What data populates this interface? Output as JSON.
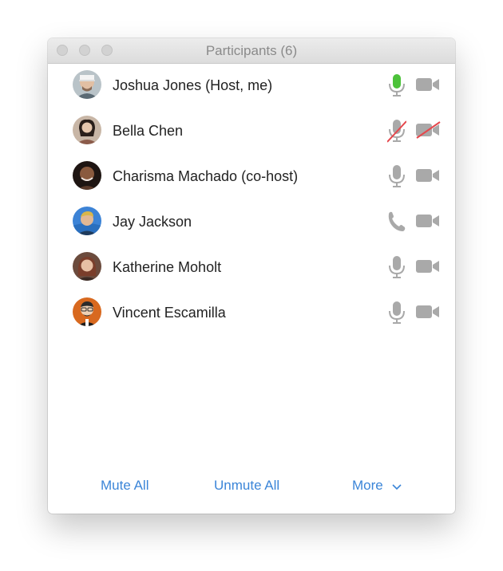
{
  "window": {
    "title": "Participants (6)"
  },
  "participants": [
    {
      "name": "Joshua Jones (Host, me)",
      "audio": "mic-active",
      "video": "camera"
    },
    {
      "name": "Bella Chen",
      "audio": "mic-muted-slashed",
      "video": "camera-off"
    },
    {
      "name": "Charisma Machado (co-host)",
      "audio": "mic",
      "video": "camera"
    },
    {
      "name": "Jay Jackson",
      "audio": "phone",
      "video": "camera"
    },
    {
      "name": "Katherine Moholt",
      "audio": "mic",
      "video": "camera"
    },
    {
      "name": "Vincent Escamilla",
      "audio": "mic",
      "video": "camera"
    }
  ],
  "footer": {
    "mute_all": "Mute All",
    "unmute_all": "Unmute All",
    "more": "More"
  },
  "colors": {
    "accent": "#3b85d8",
    "mic_active": "#4cc23a",
    "muted_slash": "#e5484d",
    "icon_gray": "#a9a9a9"
  }
}
